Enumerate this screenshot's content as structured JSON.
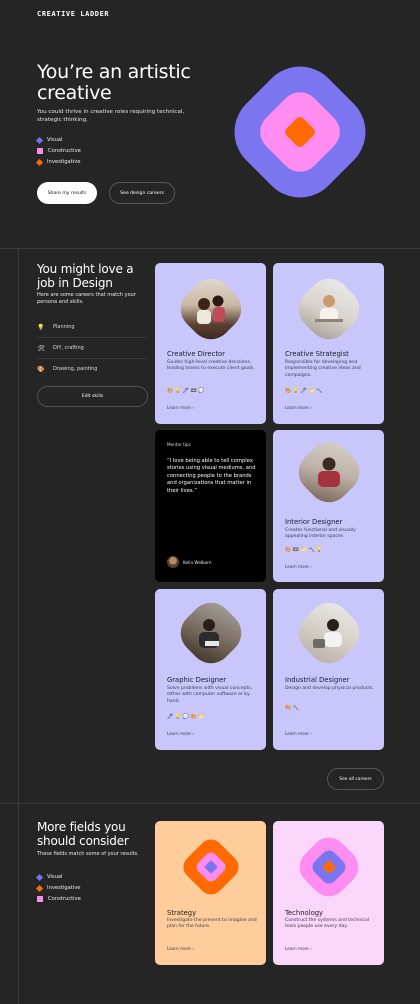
{
  "brand": {
    "logo": "CREATIVE LADDER"
  },
  "hero": {
    "title": "You’re an artistic creative",
    "subtitle": "You could thrive in creative roles requiring technical, strategic thinking.",
    "traits": [
      {
        "label": "Visual",
        "color": "#7b6ff0",
        "shape": "diamond"
      },
      {
        "label": "Constructive",
        "color": "#f58ee8",
        "shape": "square"
      },
      {
        "label": "Investigative",
        "color": "#ff6a00",
        "shape": "diamond"
      }
    ],
    "primary_button": "Share my results",
    "secondary_button": "See design careers",
    "art_colors": {
      "outer": "#7b75f0",
      "middle": "#ff8cf0",
      "inner": "#ff6a00"
    }
  },
  "design": {
    "title": "You might love a job in Design",
    "subtitle": "Here are some careers that match your persona and skills.",
    "skills": [
      {
        "icon": "lightbulb-icon",
        "glyph": "💡",
        "label": "Planning"
      },
      {
        "icon": "tools-icon",
        "glyph": "🛠",
        "label": "DIY, crafting"
      },
      {
        "icon": "palette-icon",
        "glyph": "🎨",
        "label": "Drawing, painting"
      }
    ],
    "edit_button": "Edit skills",
    "learn_more": "Learn more",
    "careers": [
      {
        "title": "Creative Director",
        "desc": "Guides high-level creative decisions, leading teams to execute client goals.",
        "icons": "🎨 💡 🖊 📼 💬"
      },
      {
        "title": "Creative Strategist",
        "desc": "Responsible for developing and implementing creative ideas and campaigns.",
        "icons": "🎨 💡 🖊 📁 🔨"
      },
      {
        "title": "Interior Designer",
        "desc": "Creates functional and visually appealing interior spaces",
        "icons": "🎨 📼 📁 🔨 💡"
      },
      {
        "title": "Graphic Designer",
        "desc": "Solve problems with visual concepts, either with computer software or by hand.",
        "icons": "🖊 💡 💬 🎨 📁"
      },
      {
        "title": "Industrial Designer",
        "desc": "Design and develop physical products.",
        "icons": "🎨 🔨"
      }
    ],
    "mentor": {
      "label": "Mentor tips",
      "quote": "“I love being able to tell complex stories using visual mediums, and connecting people to the brands and organizations that matter in their lives.”",
      "name": "Kelin Welborn"
    },
    "see_all": "See all careers"
  },
  "fields": {
    "title": "More fields you should consider",
    "subtitle": "These fields match some of your results.",
    "traits": [
      {
        "label": "Visual",
        "color": "#7b6ff0",
        "shape": "diamond"
      },
      {
        "label": "Investigative",
        "color": "#ff6a00",
        "shape": "diamond"
      },
      {
        "label": "Constructive",
        "color": "#f58ee8",
        "shape": "square"
      }
    ],
    "cards": [
      {
        "title": "Strategy",
        "desc": "Investigate the present to imagine and plan for the future."
      },
      {
        "title": "Technology",
        "desc": "Construct the systems and technical tools people use every day."
      }
    ],
    "learn_more": "Learn more"
  }
}
